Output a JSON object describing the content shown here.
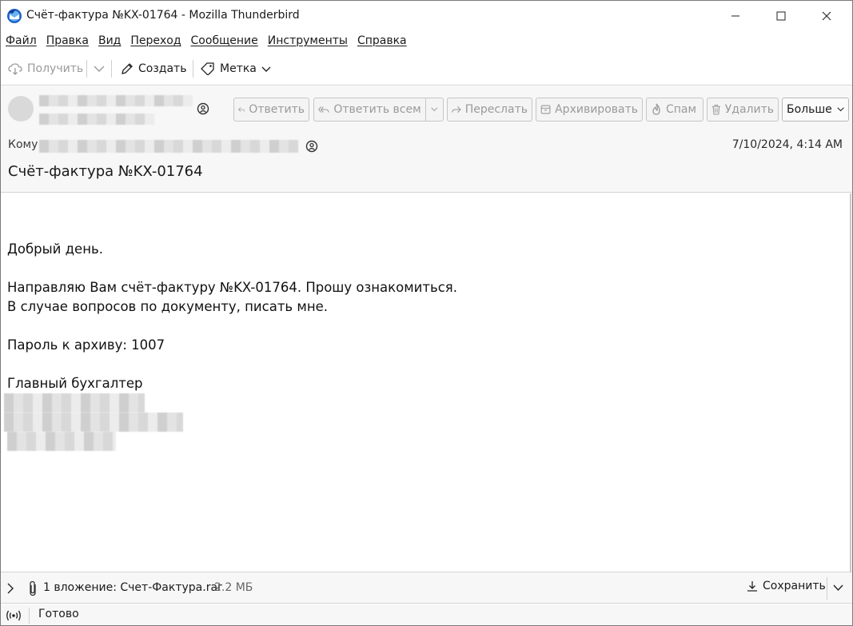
{
  "window": {
    "title": "Счёт-фактура №KX-01764 - Mozilla Thunderbird"
  },
  "menu": [
    "Файл",
    "Правка",
    "Вид",
    "Переход",
    "Сообщение",
    "Инструменты",
    "Справка"
  ],
  "toolbar": {
    "get_label": "Получить",
    "write_label": "Создать",
    "tag_label": "Метка"
  },
  "header_buttons": {
    "reply": "Ответить",
    "reply_all": "Ответить всем",
    "forward": "Переслать",
    "archive": "Архивировать",
    "spam": "Спам",
    "delete": "Удалить",
    "more": "Больше"
  },
  "header": {
    "to_label": "Кому",
    "date": "7/10/2024, 4:14 AM",
    "subject": "Счёт-фактура №KX-01764"
  },
  "body": {
    "lines": [
      "Добрый день.",
      "Направляю Вам счёт-фактуру №KX-01764. Прошу ознакомиться.",
      "В случае вопросов по документу, писать мне.",
      "Пароль к архиву: 1007",
      "Главный бухгалтер"
    ]
  },
  "attachment": {
    "summary": "1 вложение: Счет-Фактура.rar",
    "size": "2.2 МБ",
    "save_label": "Сохранить"
  },
  "status": {
    "text": "Готово"
  },
  "colors": {
    "accent_blue": "#2a6fd6",
    "disabled_text": "#9a9a9a",
    "pane_bg": "#f7f7f7"
  },
  "icons": {
    "app": "thunderbird-icon",
    "get": "cloud-download-icon",
    "write": "pencil-icon",
    "tag": "tag-icon",
    "reply": "reply-icon",
    "reply_all": "reply-all-icon",
    "forward": "forward-icon",
    "archive": "archive-icon",
    "spam": "flame-icon",
    "delete": "trash-icon",
    "attachment": "paperclip-icon",
    "save": "download-icon",
    "status": "wifi-signal-icon"
  }
}
